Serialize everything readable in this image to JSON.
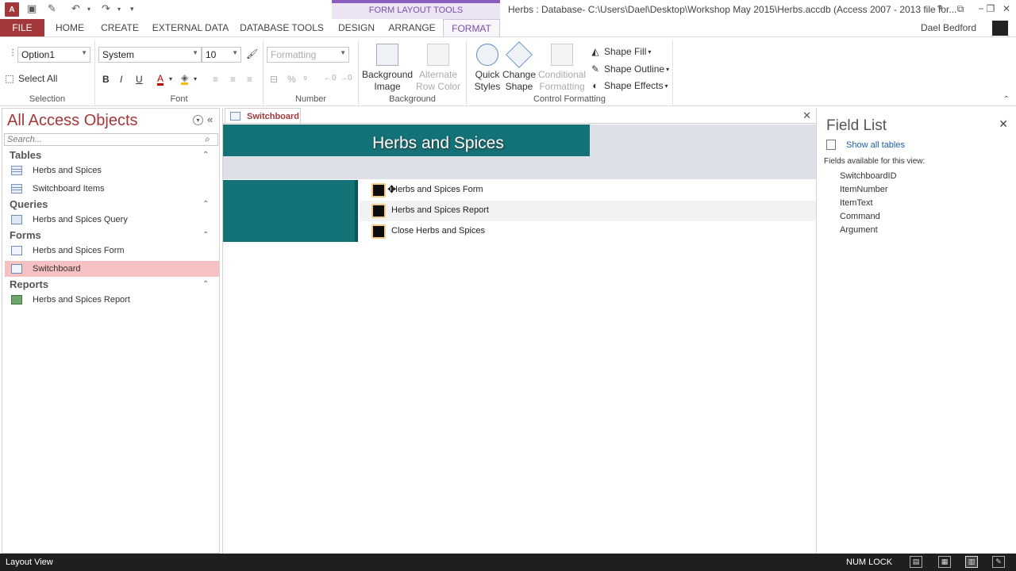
{
  "title_bar": {
    "app_icon": "A",
    "window_title": "Herbs : Database- C:\\Users\\Dael\\Desktop\\Workshop May 2015\\Herbs.accdb (Access 2007 - 2013 file for...",
    "context_group": "FORM LAYOUT TOOLS",
    "help": "?",
    "window_controls": [
      "restore-icon",
      "minimize-icon",
      "maximize-icon",
      "close-icon"
    ]
  },
  "tabs": {
    "file": "FILE",
    "home": "HOME",
    "create": "CREATE",
    "external_data": "EXTERNAL DATA",
    "database_tools": "DATABASE TOOLS",
    "design": "DESIGN",
    "arrange": "ARRANGE",
    "format": "FORMAT"
  },
  "user": {
    "name": "Dael Bedford"
  },
  "ribbon": {
    "selection": {
      "label": "Selection",
      "object_combo": "Option1",
      "select_all": "Select All"
    },
    "font": {
      "label": "Font",
      "font_name": "System",
      "font_size": "10",
      "bold": "B",
      "italic": "I",
      "underline": "U",
      "font_color": "A"
    },
    "number": {
      "label": "Number",
      "format_combo": "Formatting",
      "percent": "%"
    },
    "background": {
      "label": "Background",
      "background_image": "Background Image",
      "alternate_row_color": "Alternate Row Color"
    },
    "control_formatting": {
      "label": "Control Formatting",
      "quick_styles": "Quick Styles",
      "change_shape": "Change Shape",
      "conditional_formatting": "Conditional Formatting",
      "shape_fill": "Shape Fill",
      "shape_outline": "Shape Outline",
      "shape_effects": "Shape Effects"
    }
  },
  "nav_pane": {
    "title": "All Access Objects",
    "search_placeholder": "Search...",
    "groups": {
      "tables": {
        "label": "Tables",
        "items": [
          "Herbs and Spices",
          "Switchboard Items"
        ]
      },
      "queries": {
        "label": "Queries",
        "items": [
          "Herbs and Spices Query"
        ]
      },
      "forms": {
        "label": "Forms",
        "items": [
          "Herbs and Spices Form",
          "Switchboard"
        ]
      },
      "reports": {
        "label": "Reports",
        "items": [
          "Herbs and Spices Report"
        ]
      }
    },
    "selected_item": "Switchboard"
  },
  "document": {
    "tab_label": "Switchboard",
    "form_title": "Herbs and Spices",
    "switchboard_items": [
      "Herbs and Spices Form",
      "Herbs and Spices Report",
      "Close Herbs and Spices"
    ],
    "colors": {
      "header": "#137277",
      "band": "#dde0e6",
      "button_border": "#f5c987"
    }
  },
  "field_list": {
    "title": "Field List",
    "show_all_tables": "Show all tables",
    "caption": "Fields available for this view:",
    "fields": [
      "SwitchboardID",
      "ItemNumber",
      "ItemText",
      "Command",
      "Argument"
    ]
  },
  "status_bar": {
    "view": "Layout View",
    "num_lock": "NUM LOCK"
  },
  "colors": {
    "access_red": "#a4373a",
    "context_purple": "#7b4ea8",
    "selection_pink": "#f6c1c2",
    "status_bar": "#1f1f1f"
  }
}
